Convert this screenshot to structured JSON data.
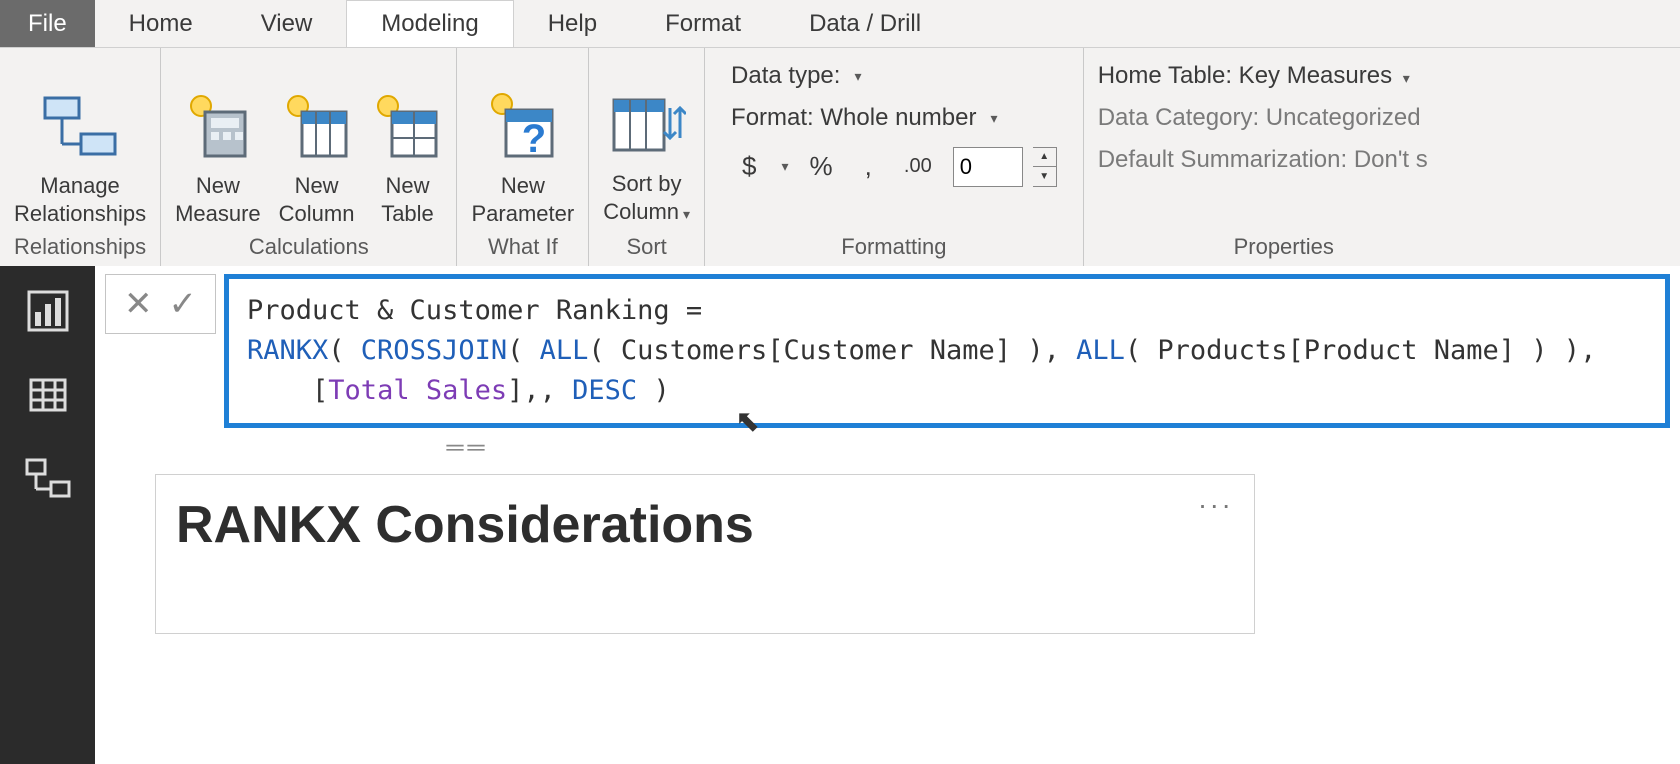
{
  "menu": {
    "file": "File",
    "tabs": [
      "Home",
      "View",
      "Modeling",
      "Help",
      "Format",
      "Data / Drill"
    ],
    "active_index": 2
  },
  "ribbon": {
    "relationships": {
      "manage": "Manage\nRelationships",
      "group_label": "Relationships"
    },
    "calculations": {
      "new_measure": "New\nMeasure",
      "new_column": "New\nColumn",
      "new_table": "New\nTable",
      "group_label": "Calculations"
    },
    "whatif": {
      "new_parameter": "New\nParameter",
      "group_label": "What If"
    },
    "sort": {
      "sort_by_column": "Sort by\nColumn",
      "group_label": "Sort"
    },
    "formatting": {
      "data_type_label": "Data type:",
      "format_label": "Format: Whole number",
      "currency": "$",
      "percent": "%",
      "comma": ",",
      "decimal": ".00",
      "decimal_value": "0",
      "group_label": "Formatting"
    },
    "properties": {
      "home_table": "Home Table: Key Measures",
      "data_category": "Data Category: Uncategorized",
      "default_summarization": "Default Summarization: Don't s",
      "group_label": "Properties"
    }
  },
  "formula": {
    "line1_plain": "Product & Customer Ranking = ",
    "rankx": "RANKX",
    "crossjoin": "CROSSJOIN",
    "all1": "ALL",
    "tbl1": "Customers[Customer Name]",
    "all2": "ALL",
    "tbl2": "Products[Product Name]",
    "measure": "Total Sales",
    "desc": "DESC"
  },
  "visual": {
    "title": "RANKX Considerations",
    "menu": "..."
  },
  "icons": {
    "cancel": "✕",
    "commit": "✓"
  }
}
